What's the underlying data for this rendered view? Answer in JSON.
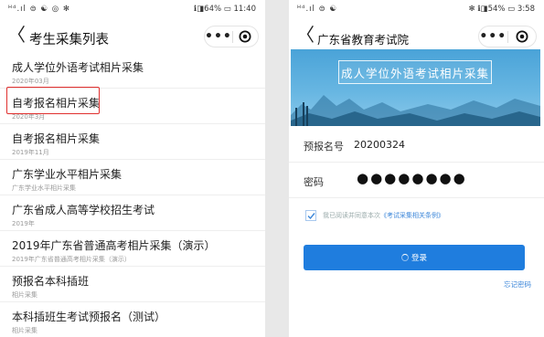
{
  "left": {
    "status": {
      "left": "ᴴᵈ.ıl ⊜ ☯ ◎ ✻",
      "right": "ℹ◨64% ▭ 11:40"
    },
    "nav": {
      "back": "〈",
      "title": "考生采集列表",
      "more": "•••"
    },
    "items": [
      {
        "title": "成人学位外语考试相片采集",
        "sub": "2020年03月"
      },
      {
        "title": "自考报名相片采集",
        "sub": "2020年3月"
      },
      {
        "title": "自考报名相片采集",
        "sub": "2019年11月"
      },
      {
        "title": "广东学业水平相片采集",
        "sub": "广东学业水平相片采集"
      },
      {
        "title": "广东省成人高等学校招生考试",
        "sub": "2019年"
      },
      {
        "title": "2019年广东省普通高考相片采集（演示）",
        "sub": "2019年广东省普通高考相片采集（演示）"
      },
      {
        "title": "预报名本科插班",
        "sub": "相片采集"
      },
      {
        "title": "本科插班生考试预报名（测试）",
        "sub": "相片采集"
      }
    ]
  },
  "right": {
    "status": {
      "left": "ᴴᵈ.ıl ⊜ ☯",
      "right": "✻ ℹ◨54% ▭ 3:58"
    },
    "nav": {
      "back": "〈",
      "title": "广东省教育考试院",
      "more": "•••"
    },
    "banner_title": "成人学位外语考试相片采集",
    "form": {
      "id_label": "预报名号",
      "id_value": "20200324",
      "pwd_label": "密码",
      "pwd_value": "●●●●●●●●"
    },
    "agree_text": "我已阅读并同意本次",
    "agree_link": "《考试采集相关条例》",
    "login_label": "登录",
    "forgot_label": "忘记密码"
  },
  "colors": {
    "primary": "#1f7dde",
    "link": "#3b86d9",
    "highlight": "#e0302f",
    "banner": "#4aa3d8"
  }
}
